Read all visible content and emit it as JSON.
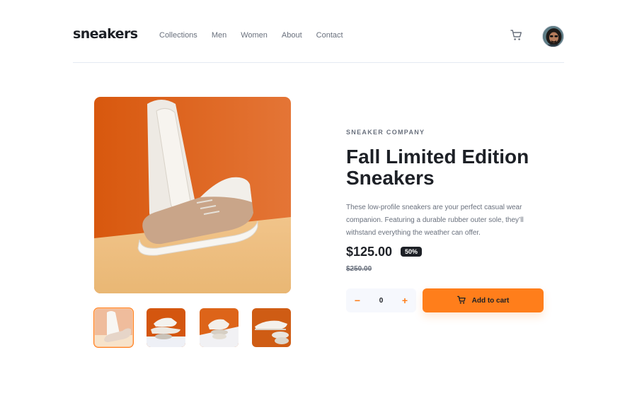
{
  "header": {
    "logo": "sneakers",
    "nav": [
      "Collections",
      "Men",
      "Women",
      "About",
      "Contact"
    ],
    "cart_icon": "cart-icon",
    "avatar_icon": "user-avatar"
  },
  "gallery": {
    "main_image": "sneaker-photo-1",
    "thumbnails": [
      "sneaker-photo-1",
      "sneaker-photo-2",
      "sneaker-photo-3",
      "sneaker-photo-4"
    ],
    "active_thumbnail": 0
  },
  "product": {
    "company": "SNEAKER COMPANY",
    "title": "Fall Limited Edition Sneakers",
    "description": "These low-profile sneakers are your perfect casual wear companion. Featuring a durable rubber outer sole, they’ll withstand everything the weather can offer.",
    "price": "$125.00",
    "discount": "50%",
    "original_price": "$250.00"
  },
  "cart": {
    "minus": "−",
    "quantity": "0",
    "plus": "+",
    "add_label": "Add to cart",
    "add_icon": "cart-icon"
  },
  "colors": {
    "accent": "#ff7e1b",
    "dark": "#1d2026",
    "muted": "#69707d",
    "light": "#f6f8fd"
  }
}
